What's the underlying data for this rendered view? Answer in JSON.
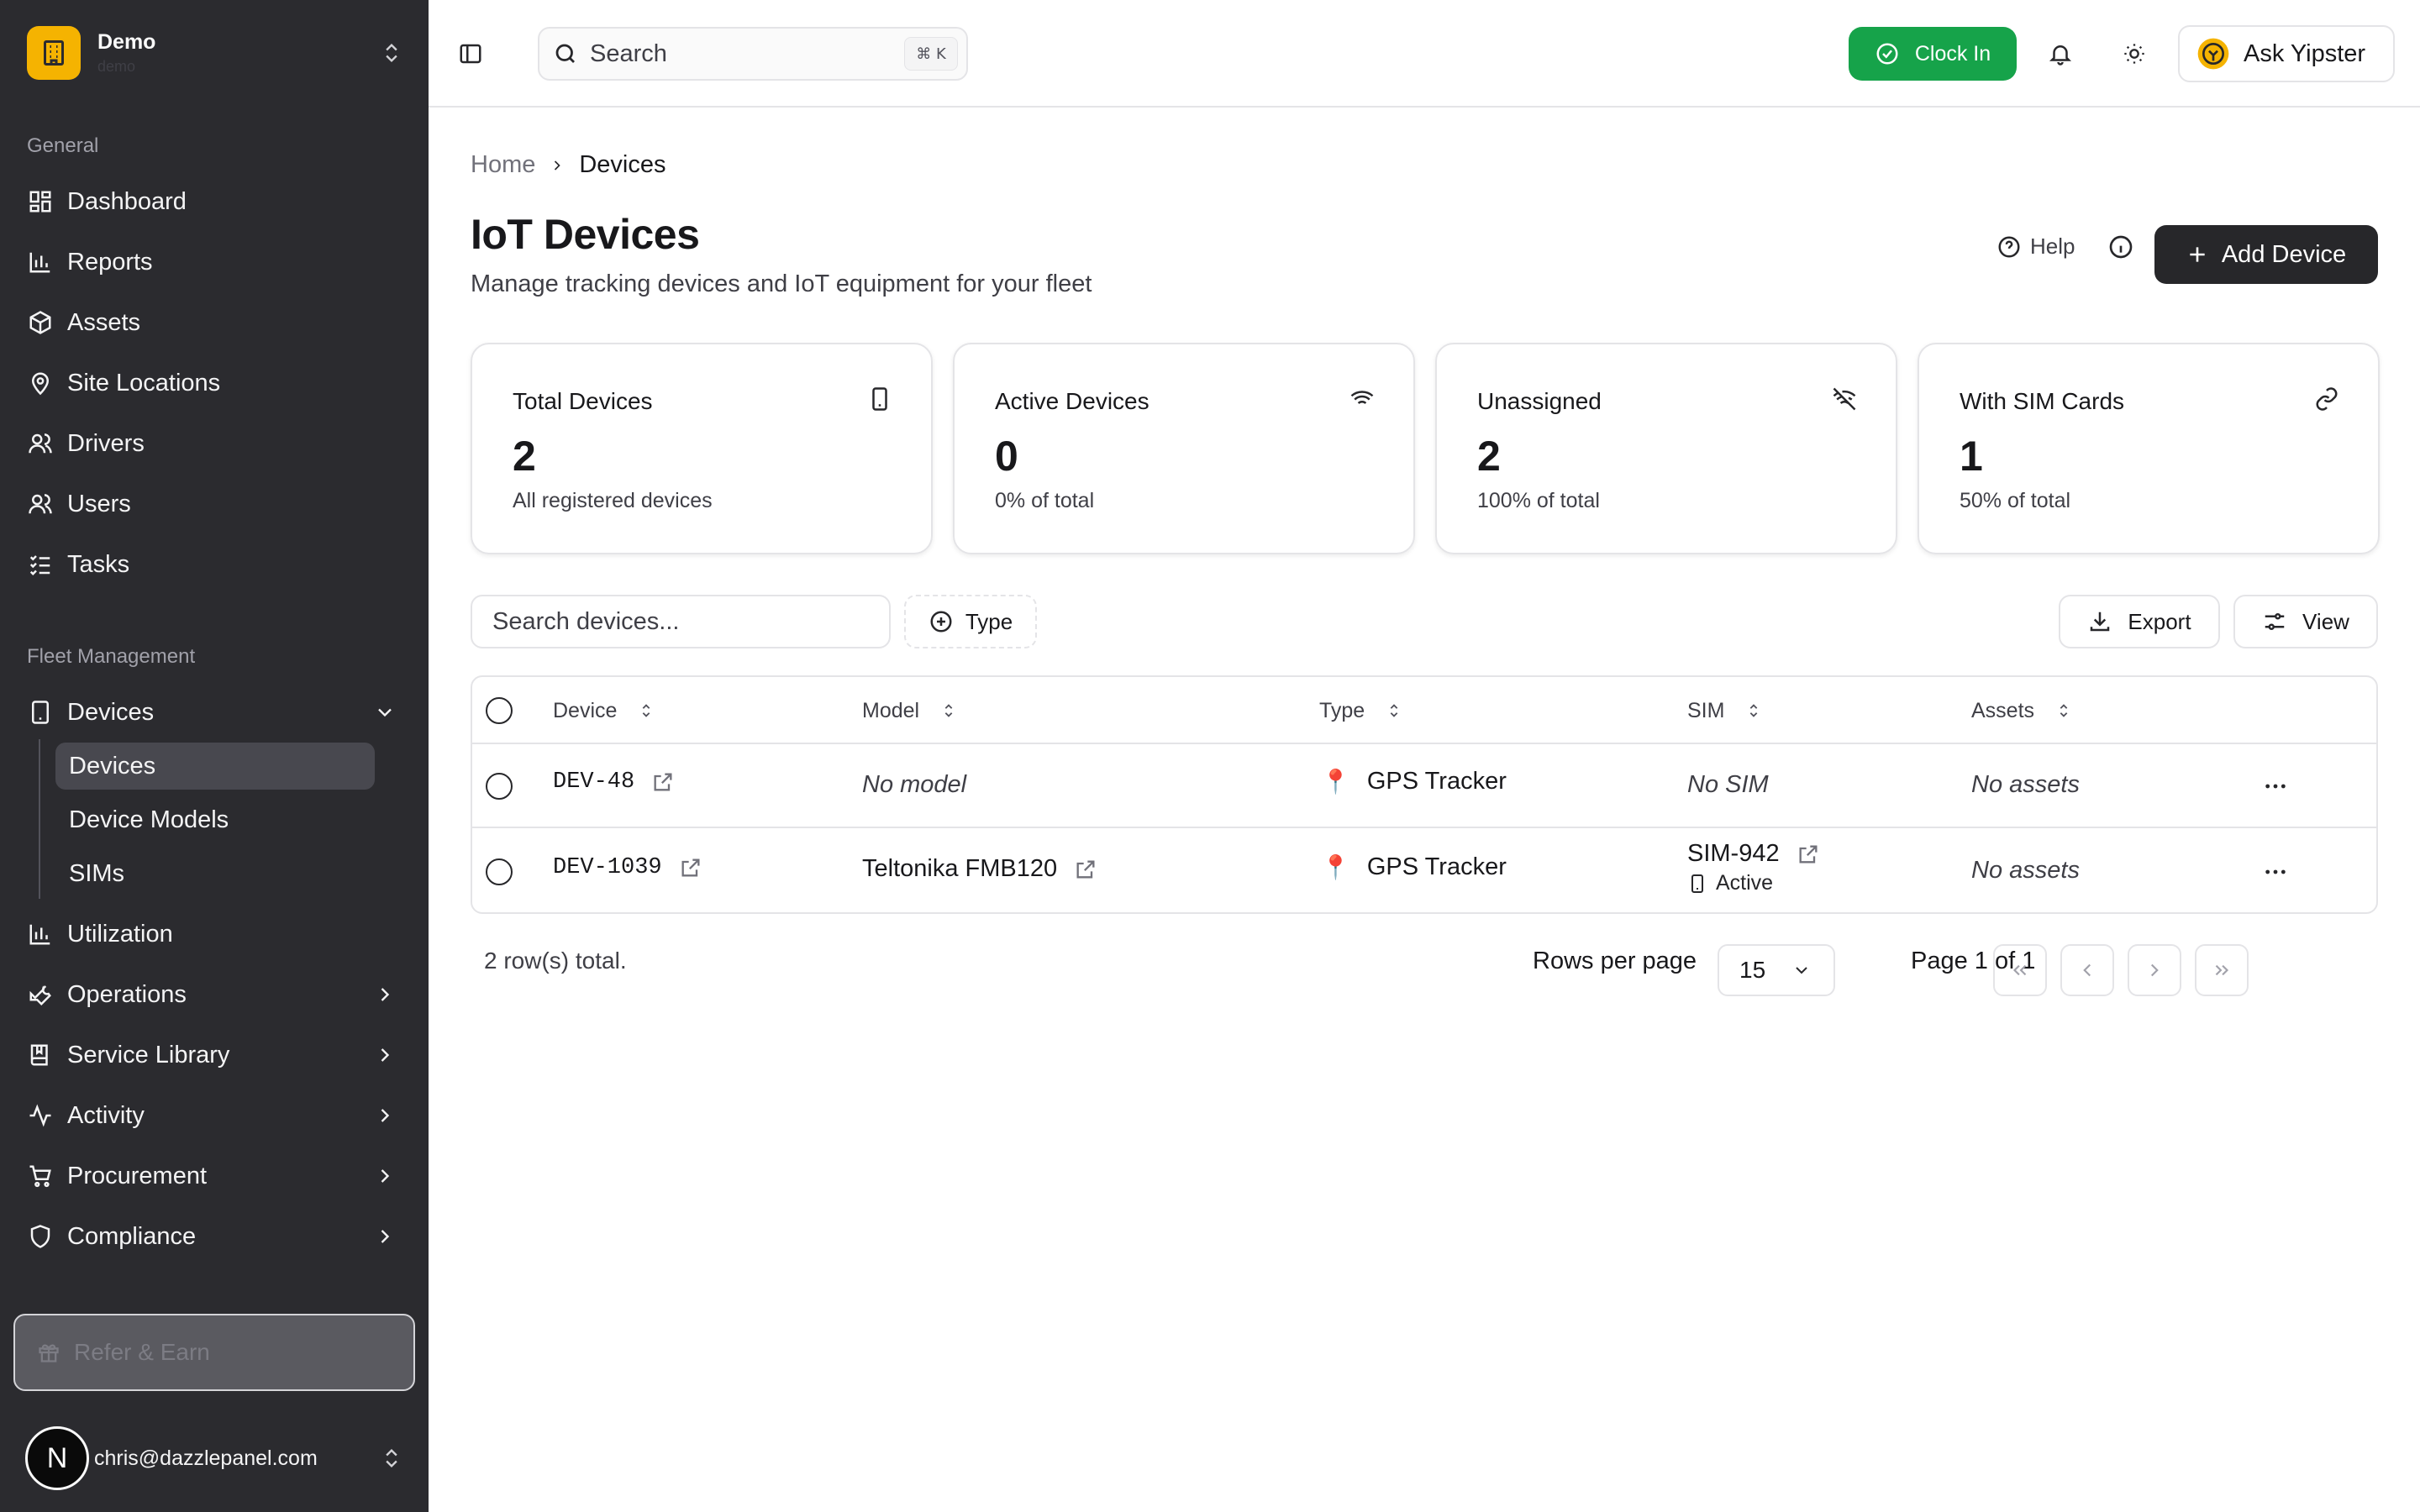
{
  "colors": {
    "sidebar_bg": "#2b2b2f",
    "brand": "#f5b301",
    "accent_green": "#16a34a",
    "primary_button": "#27272a"
  },
  "org": {
    "name": "Demo",
    "sub": "demo",
    "icon": "building-icon"
  },
  "sidebar": {
    "general_label": "General",
    "general_items": [
      {
        "label": "Dashboard",
        "icon": "dashboard-icon"
      },
      {
        "label": "Reports",
        "icon": "bar-chart-icon"
      },
      {
        "label": "Assets",
        "icon": "box-icon"
      },
      {
        "label": "Site Locations",
        "icon": "map-pin-icon"
      },
      {
        "label": "Drivers",
        "icon": "users-icon"
      },
      {
        "label": "Users",
        "icon": "users-icon"
      },
      {
        "label": "Tasks",
        "icon": "list-checks-icon"
      }
    ],
    "fleet_label": "Fleet Management",
    "devices": {
      "label": "Devices",
      "icon": "tablet-icon"
    },
    "devices_sub": [
      {
        "label": "Devices",
        "active": true
      },
      {
        "label": "Device Models",
        "active": false
      },
      {
        "label": "SIMs",
        "active": false
      }
    ],
    "fleet_items": [
      {
        "label": "Utilization",
        "icon": "bar-chart-icon",
        "chevron": false
      },
      {
        "label": "Operations",
        "icon": "wrench-icon",
        "chevron": true
      },
      {
        "label": "Service Library",
        "icon": "book-icon",
        "chevron": true
      },
      {
        "label": "Activity",
        "icon": "activity-icon",
        "chevron": true
      },
      {
        "label": "Procurement",
        "icon": "cart-icon",
        "chevron": true
      },
      {
        "label": "Compliance",
        "icon": "shield-icon",
        "chevron": true
      }
    ],
    "refer_label": "Refer & Earn",
    "user_initial": "N",
    "user_email": "chris@dazzlepanel.com"
  },
  "topbar": {
    "search_label": "Search",
    "search_shortcut": "⌘ K",
    "clock_in_label": "Clock In",
    "ask_label": "Ask Yipster"
  },
  "page": {
    "breadcrumb_home": "Home",
    "breadcrumb_current": "Devices",
    "title": "IoT Devices",
    "subtitle": "Manage tracking devices and IoT equipment for your fleet",
    "help_label": "Help",
    "add_label": "Add Device"
  },
  "stats": [
    {
      "title": "Total Devices",
      "value": "2",
      "sub": "All registered devices",
      "icon": "tablet-icon"
    },
    {
      "title": "Active Devices",
      "value": "0",
      "sub": "0% of total",
      "icon": "wifi-icon"
    },
    {
      "title": "Unassigned",
      "value": "2",
      "sub": "100% of total",
      "icon": "wifi-off-icon"
    },
    {
      "title": "With SIM Cards",
      "value": "1",
      "sub": "50% of total",
      "icon": "link-icon"
    }
  ],
  "toolbar": {
    "search_placeholder": "Search devices...",
    "type_label": "Type",
    "export_label": "Export",
    "view_label": "View"
  },
  "table": {
    "columns": [
      "Device",
      "Model",
      "Type",
      "SIM",
      "Assets"
    ],
    "rows": [
      {
        "device": "DEV-48",
        "model": "No model",
        "type": "GPS Tracker",
        "sim": "No SIM",
        "sim_status": "",
        "assets": "No assets"
      },
      {
        "device": "DEV-1039",
        "model": "Teltonika FMB120",
        "type": "GPS Tracker",
        "sim": "SIM-942",
        "sim_status": "Active",
        "assets": "No assets"
      }
    ]
  },
  "pagination": {
    "total_text": "2 row(s) total.",
    "rows_per_page_label": "Rows per page",
    "rows_per_page": "15",
    "page_text": "Page 1 of 1"
  }
}
